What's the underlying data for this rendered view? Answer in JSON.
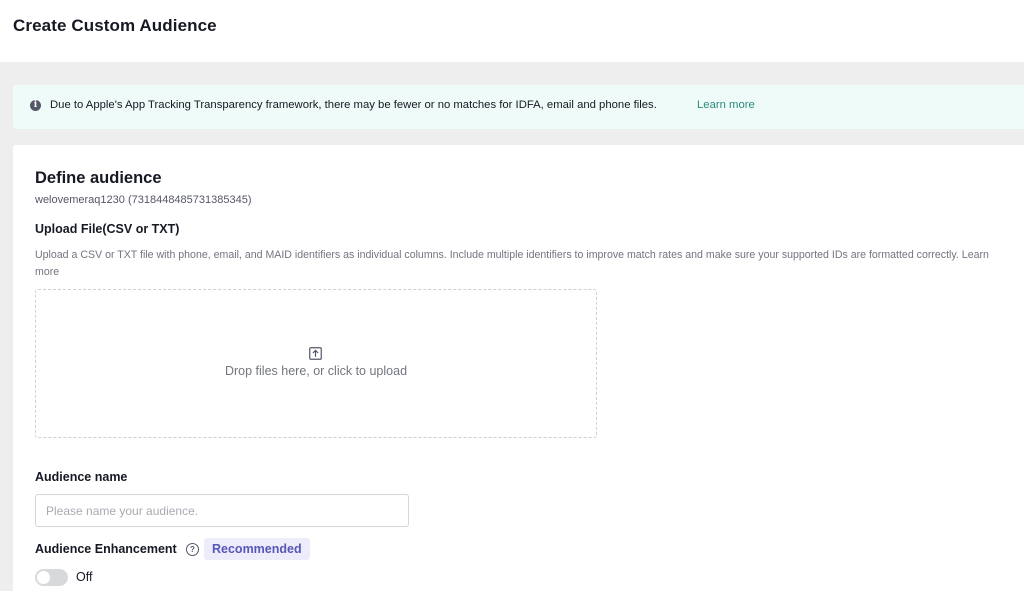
{
  "header": {
    "title": "Create Custom Audience"
  },
  "banner": {
    "icon": "info-icon",
    "message": "Due to Apple's App Tracking Transparency framework, there may be fewer or no matches for IDFA, email and phone files.",
    "link_label": "Learn more"
  },
  "define": {
    "title": "Define audience",
    "account": "welovemeraq1230 (7318448485731385345)"
  },
  "upload": {
    "title": "Upload File(CSV or TXT)",
    "description": "Upload a CSV or TXT file with phone, email, and MAID identifiers as individual columns. Include multiple identifiers to improve match rates and make sure your supported IDs are formatted correctly.",
    "description_link": "Learn more",
    "icon": "upload-icon",
    "drop_text": "Drop files here, or click to upload"
  },
  "audience_name": {
    "label": "Audience name",
    "value": "",
    "placeholder": "Please name your audience."
  },
  "enhancement": {
    "label": "Audience Enhancement",
    "help_icon": "question-circle-icon",
    "badge": "Recommended",
    "toggle_state": "Off"
  },
  "colors": {
    "banner_bg": "#eefbf8",
    "link": "#2b8a7f",
    "badge_bg": "#ececfb",
    "badge_text": "#5856b8",
    "page_bg": "#eeeeef"
  }
}
